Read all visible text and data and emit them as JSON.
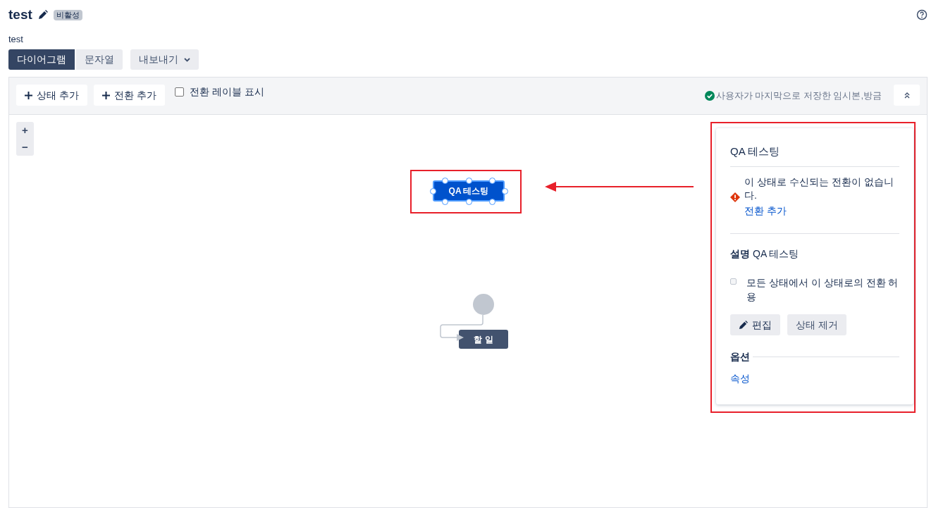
{
  "header": {
    "title": "test",
    "status_badge": "비활성",
    "description": "test"
  },
  "view_tabs": [
    {
      "label": "다이어그램",
      "selected": true
    },
    {
      "label": "문자열",
      "selected": false
    }
  ],
  "export_button": "내보내기",
  "toolbar": {
    "buttons": [
      "상태 추가",
      "전환 추가"
    ],
    "show_labels": {
      "label": "전환 레이블 표시",
      "checked": false
    },
    "save_status": "사용자가 마지막으로 저장한 임시본,방금"
  },
  "zoom_controls": [
    "+",
    "−"
  ],
  "diagram": {
    "nodes": [
      {
        "kind": "status",
        "label": "QA 테스팅",
        "selected": true,
        "color": "#0052cc"
      },
      {
        "kind": "start"
      },
      {
        "kind": "status",
        "label": "할 일",
        "selected": false,
        "color": "#42526e"
      }
    ]
  },
  "side_panel": {
    "title": "QA 테스팅",
    "warning": "이 상태로 수신되는 전환이 없습니다.",
    "warning_link": "전환 추가",
    "description_label": "설명",
    "description_value": "QA 테스팅",
    "allow_all": {
      "label": "모든 상태에서 이 상태로의 전환 허용",
      "checked": false
    },
    "buttons": [
      "편집",
      "상태 제거"
    ],
    "options_heading": "옵션",
    "options_links": [
      "속성"
    ]
  }
}
